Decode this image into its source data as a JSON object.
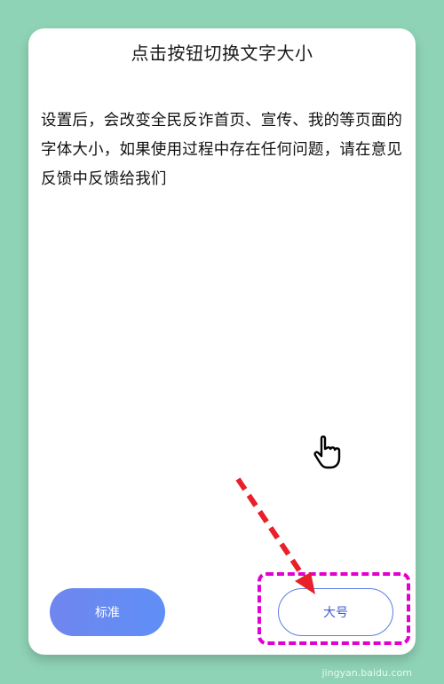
{
  "dialog": {
    "title": "点击按钮切换文字大小",
    "description": "设置后，会改变全民反诈首页、宣传、我的等页面的字体大小，如果使用过程中存在任何问题，请在意见反馈中反馈给我们"
  },
  "buttons": {
    "standard_label": "标准",
    "large_label": "大号"
  },
  "watermark": "jingyan.baidu.com",
  "colors": {
    "background": "#8fd3b6",
    "primary_gradient_start": "#6f86ee",
    "primary_gradient_end": "#5f8ff6",
    "highlight": "#e000d0",
    "arrow": "#e8202a"
  },
  "icons": {
    "cursor": "hand-pointer-icon",
    "arrow": "red-dashed-arrow-icon"
  }
}
